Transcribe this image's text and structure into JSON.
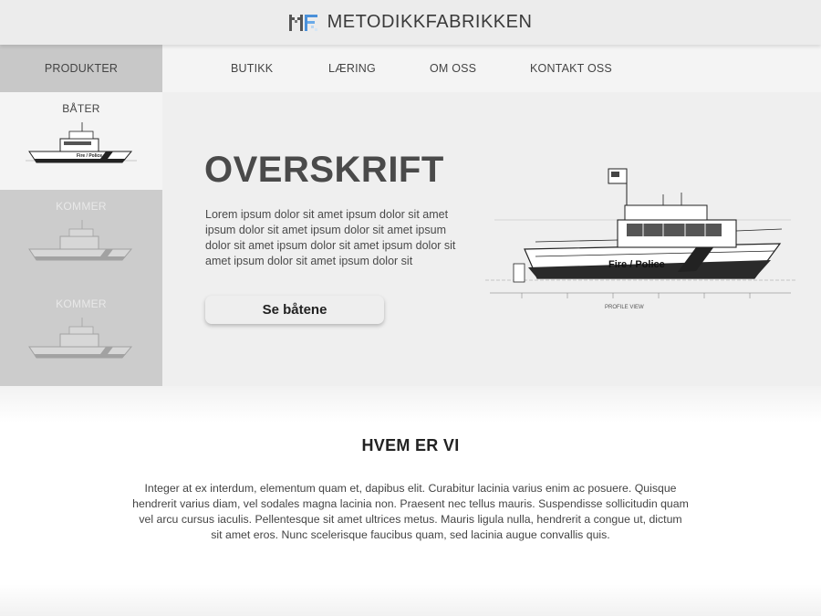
{
  "header": {
    "brand": "METODIKKFABRIKKEN",
    "logo_icon": "mf-pixel-logo-icon",
    "colors": {
      "logo_gray": "#555555",
      "logo_blue": "#4a90d9"
    }
  },
  "nav": {
    "items": [
      {
        "label": "PRODUKTER",
        "active": true
      },
      {
        "label": "BUTIKK"
      },
      {
        "label": "LÆRING"
      },
      {
        "label": "OM OSS"
      },
      {
        "label": "KONTAKT OSS"
      }
    ]
  },
  "sidebar": {
    "cards": [
      {
        "title": "BÅTER",
        "active": true,
        "image_icon": "boat-drawing-icon"
      },
      {
        "title": "KOMMER",
        "disabled": true,
        "image_icon": "boat-drawing-icon"
      },
      {
        "title": "KOMMER",
        "disabled": true,
        "image_icon": "boat-drawing-icon"
      }
    ]
  },
  "hero": {
    "heading": "OVERSKRIFT",
    "text": "Lorem ipsum dolor sit amet ipsum dolor sit amet ipsum dolor sit amet ipsum dolor sit amet ipsum dolor sit amet ipsum dolor sit amet ipsum dolor sit amet ipsum dolor sit amet ipsum dolor sit",
    "cta_label": "Se båtene",
    "boat_label": "Fire / Police",
    "boat_caption": "PROFILE VIEW"
  },
  "about": {
    "title": "HVEM ER VI",
    "text": "Integer at ex interdum, elementum quam et, dapibus elit. Curabitur lacinia varius enim ac posuere. Quisque hendrerit varius diam, vel sodales magna lacinia non. Praesent nec tellus mauris. Suspendisse sollicitudin quam vel arcu cursus iaculis. Pellentesque sit amet ultrices metus. Mauris ligula nulla, hendrerit a congue ut, dictum sit amet eros. Nunc scelerisque faucibus quam, sed lacinia augue convallis quis."
  }
}
